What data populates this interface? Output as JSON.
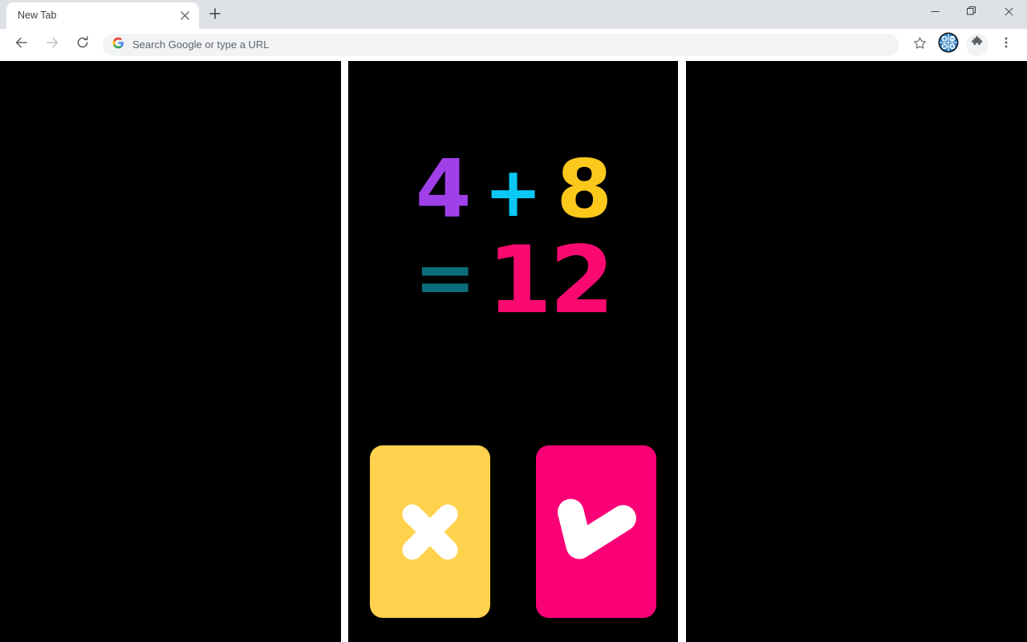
{
  "browser": {
    "tab": {
      "title": "New Tab",
      "close_icon": "close-icon"
    },
    "newtab_button_icon": "plus-icon",
    "window_controls": {
      "minimize_icon": "minimize-icon",
      "maximize_icon": "maximize-restore-icon",
      "close_icon": "window-close-icon"
    },
    "toolbar": {
      "back_icon": "back-arrow-icon",
      "forward_icon": "forward-arrow-icon",
      "reload_icon": "reload-icon",
      "omnibox": {
        "search_engine_icon": "google-g-icon",
        "placeholder": "Search Google or type a URL",
        "value": ""
      },
      "bookmark_icon": "star-icon",
      "profile_icon": "math-operators-avatar-icon",
      "extensions_icon": "puzzle-piece-icon",
      "menu_icon": "three-dot-menu-icon"
    }
  },
  "app": {
    "background": "#000000",
    "equation": {
      "operand_a": "4",
      "operator": "+",
      "operand_b": "8",
      "equals": "=",
      "result": "12",
      "full_text": "4 + 8 = 12"
    },
    "answers": [
      {
        "id": "false",
        "label": "",
        "icon": "cross-icon",
        "background": "#FFD24D",
        "icon_color": "#FFFFFF",
        "meaning": "incorrect"
      },
      {
        "id": "true",
        "label": "",
        "icon": "check-icon",
        "background": "#FA0076",
        "icon_color": "#FFFFFF",
        "meaning": "correct"
      }
    ],
    "colors": {
      "operand_a": "#A040E8",
      "operator": "#0AC8F5",
      "operand_b": "#FDC81C",
      "equals": "#0A6E7A",
      "result": "#FA0A70"
    }
  }
}
